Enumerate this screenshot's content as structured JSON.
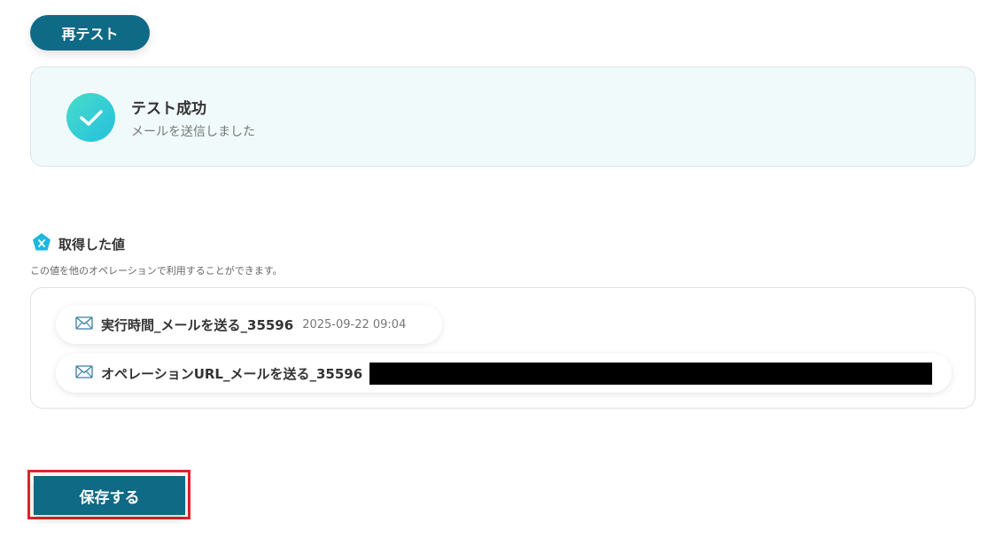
{
  "toolbar": {
    "retest_label": "再テスト"
  },
  "result": {
    "title": "テスト成功",
    "subtitle": "メールを送信しました",
    "icon": "check-circle-icon"
  },
  "values": {
    "title": "取得した値",
    "description": "この値を他のオペレーションで利用することができます。",
    "items": [
      {
        "label": "実行時間_メールを送る_35596",
        "value": "2025-09-22 09:04",
        "icon": "mail-icon"
      },
      {
        "label": "オペレーションURL_メールを送る_35596",
        "value": "",
        "redacted": true,
        "icon": "mail-icon"
      }
    ]
  },
  "footer": {
    "save_label": "保存する"
  },
  "colors": {
    "primary": "#0f6a86",
    "success_bg": "#f1fafa",
    "check_gradient_start": "#48dcc9",
    "check_gradient_end": "#25c0e0",
    "highlight": "#e2232b"
  }
}
